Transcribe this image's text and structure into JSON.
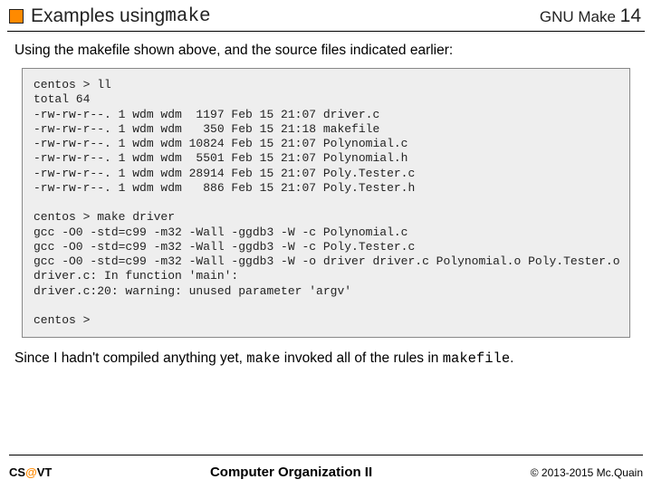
{
  "header": {
    "title_prefix": "Examples using ",
    "title_cmd": "make",
    "right_prefix": "GNU Make ",
    "right_num": "14"
  },
  "body": {
    "intro": "Using the makefile shown above, and the source files indicated earlier:",
    "code": "centos > ll\ntotal 64\n-rw-rw-r--. 1 wdm wdm  1197 Feb 15 21:07 driver.c\n-rw-rw-r--. 1 wdm wdm   350 Feb 15 21:18 makefile\n-rw-rw-r--. 1 wdm wdm 10824 Feb 15 21:07 Polynomial.c\n-rw-rw-r--. 1 wdm wdm  5501 Feb 15 21:07 Polynomial.h\n-rw-rw-r--. 1 wdm wdm 28914 Feb 15 21:07 Poly.Tester.c\n-rw-rw-r--. 1 wdm wdm   886 Feb 15 21:07 Poly.Tester.h\n\ncentos > make driver\ngcc -O0 -std=c99 -m32 -Wall -ggdb3 -W -c Polynomial.c\ngcc -O0 -std=c99 -m32 -Wall -ggdb3 -W -c Poly.Tester.c\ngcc -O0 -std=c99 -m32 -Wall -ggdb3 -W -o driver driver.c Polynomial.o Poly.Tester.o\ndriver.c: In function 'main':\ndriver.c:20: warning: unused parameter 'argv'\n\ncentos >",
    "conclusion_1": "Since I hadn't compiled anything yet, ",
    "conclusion_cmd1": "make",
    "conclusion_2": " invoked all of the rules in ",
    "conclusion_cmd2": "makefile",
    "conclusion_3": "."
  },
  "footer": {
    "left_cs": "CS",
    "left_at": "@",
    "left_vt": "VT",
    "center": "Computer Organization II",
    "right": "© 2013-2015 Mc.Quain"
  }
}
